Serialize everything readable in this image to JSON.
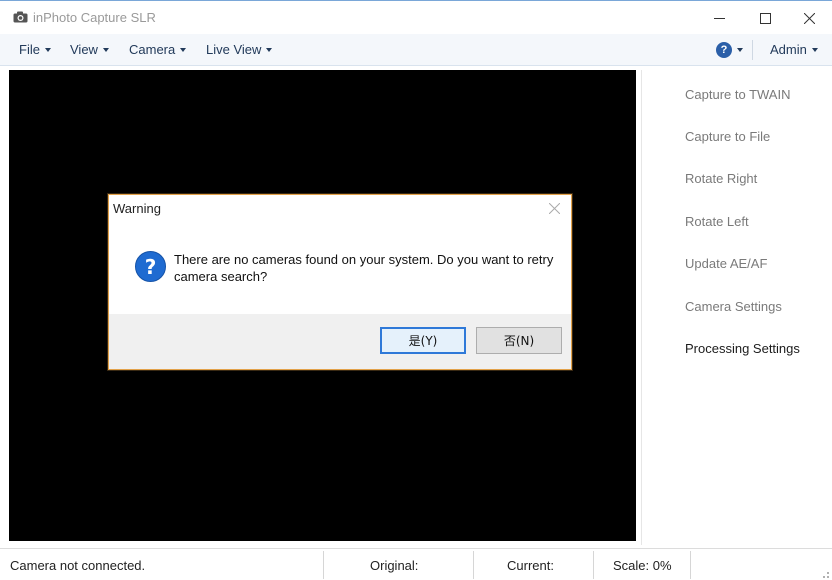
{
  "window": {
    "title": "inPhoto Capture SLR",
    "icon": "camera-icon"
  },
  "menu": {
    "items": [
      {
        "label": "File"
      },
      {
        "label": "View"
      },
      {
        "label": "Camera"
      },
      {
        "label": "Live View"
      }
    ],
    "help_icon": "question-circle-icon",
    "user_label": "Admin"
  },
  "actions": [
    {
      "label": "Capture to TWAIN"
    },
    {
      "label": "Capture to File"
    },
    {
      "label": "Rotate Right"
    },
    {
      "label": "Rotate Left"
    },
    {
      "label": "Update AE/AF"
    },
    {
      "label": "Camera Settings"
    },
    {
      "label": "Processing Settings"
    }
  ],
  "status": {
    "connection": "Camera not connected.",
    "original": "Original:",
    "current": "Current:",
    "scale": "Scale: 0%"
  },
  "dialog": {
    "title": "Warning",
    "message": "There are no cameras found on your system. Do you want to retry camera search?",
    "icon": "question-icon",
    "yes_label": "是(Y)",
    "no_label": "否(N)"
  },
  "colors": {
    "preview_bg": "#000000",
    "dialog_border": "#e3a24a",
    "question_icon": "#1f6bd1",
    "default_button_border": "#2f79d8"
  }
}
